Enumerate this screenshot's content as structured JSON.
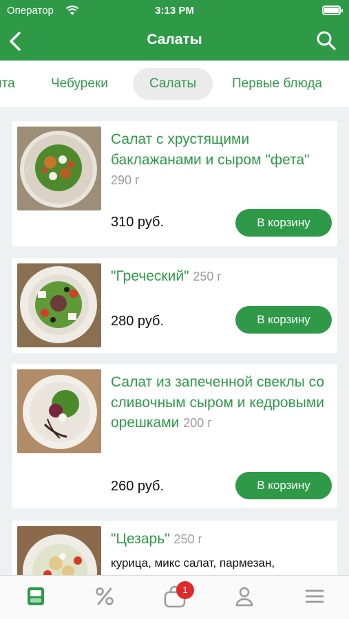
{
  "status_bar": {
    "carrier": "Оператор",
    "time": "3:13 PM"
  },
  "nav": {
    "title": "Салаты"
  },
  "categories": [
    "ита",
    "Чебуреки",
    "Салаты",
    "Первые блюда"
  ],
  "active_category": "Салаты",
  "products": [
    {
      "name": "Салат с хрустящими баклажанами и сыром \"фета\"",
      "weight": "290 г",
      "price": "310 руб.",
      "button": "В корзину"
    },
    {
      "name": "\"Греческий\"",
      "weight": "250 г",
      "price": "280 руб.",
      "button": "В корзину"
    },
    {
      "name": "Салат из запеченной свеклы со сливочным сыром и кедровыми орешками",
      "weight": "200 г",
      "price": "260 руб.",
      "button": "В корзину"
    },
    {
      "name": "\"Цезарь\"",
      "weight": "250 г",
      "description": "курица, микс салат, пармезан,"
    }
  ],
  "cart_badge": "1",
  "colors": {
    "brand": "#2e9a48",
    "badge": "#e02a2a"
  },
  "tabbar_icons": [
    "menu-icon",
    "percent-icon",
    "cart-icon",
    "profile-icon",
    "hamburger-icon"
  ]
}
